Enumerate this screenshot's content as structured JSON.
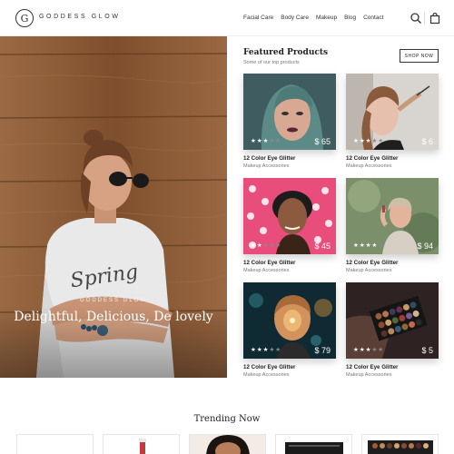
{
  "brand": {
    "logo_letter": "G",
    "name": "GODDESS GLOW"
  },
  "nav": {
    "items": [
      "Facial Care",
      "Body Care",
      "Makeup",
      "Blog",
      "Contact"
    ]
  },
  "header_icons": [
    "search-icon",
    "shopping-bag-icon"
  ],
  "hero": {
    "kicker": "GODDESS GLOW",
    "title": "Delightful, Delicious, De lovely",
    "shirt_text": "Spring"
  },
  "featured": {
    "title": "Featured Products",
    "subtitle": "Some of our top products",
    "shop_button": "SHOP NOW",
    "products": [
      {
        "name": "12 Color Eye Glitter",
        "category": "Makeup Accessories",
        "price": "$ 65",
        "rating": 3,
        "max_rating": 5
      },
      {
        "name": "12 Color Eye Glitter",
        "category": "Makeup Accessories",
        "price": "$ 6",
        "rating": 3,
        "max_rating": 5
      },
      {
        "name": "12 Color Eye Glitter",
        "category": "Makeup Accessories",
        "price": "$ 45",
        "rating": 2,
        "max_rating": 5
      },
      {
        "name": "12 Color Eye Glitter",
        "category": "Makeup Accessories",
        "price": "$ 94",
        "rating": 4,
        "max_rating": 5
      },
      {
        "name": "12 Color Eye Glitter",
        "category": "Makeup Accessories",
        "price": "$ 79",
        "rating": 3,
        "max_rating": 5
      },
      {
        "name": "12 Color Eye Glitter",
        "category": "Makeup Accessories",
        "price": "$ 5",
        "rating": 3,
        "max_rating": 5
      }
    ]
  },
  "trending": {
    "title": "Trending Now"
  },
  "colors": {
    "text_dark": "#222222",
    "text_muted": "#777777",
    "star_on": "#ffffff",
    "star_off": "#8a8a8a",
    "wood": "#8d5a34"
  }
}
